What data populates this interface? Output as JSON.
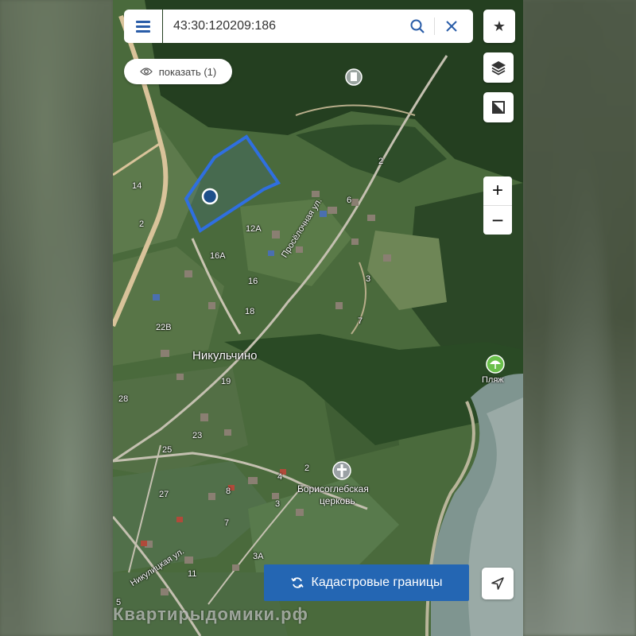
{
  "search": {
    "query": "43:30:120209:186"
  },
  "show_button": {
    "label": "показать (1)"
  },
  "cadastral_button": {
    "label": "Кадастровые границы"
  },
  "watermark": "Квартирыдомики.рф",
  "map": {
    "place_names": {
      "village": "Никульчино",
      "beach": "Пляж",
      "church_line1": "Борисоглебская",
      "church_line2": "церковь",
      "street1": "Просёлочная ул.",
      "street2": "Никулицкая ул."
    },
    "house_numbers": {
      "n14": "14",
      "n2a": "2",
      "n2b": "2",
      "n6": "6",
      "n12a": "12А",
      "n16a": "16А",
      "n16": "16",
      "n18": "18",
      "n3a": "3",
      "n7": "7",
      "n22v": "22В",
      "n19": "19",
      "n28": "28",
      "n23": "23",
      "n25": "25",
      "n2c": "2",
      "n4": "4",
      "n8": "8",
      "n3b": "3",
      "n27": "27",
      "n7b": "7",
      "n3A": "3А",
      "n11": "11",
      "n5": "5"
    },
    "colors": {
      "parcel": "#2f6fe0",
      "road": "#d9c39a",
      "accent": "#2466b3",
      "beach_icon": "#6abf4b"
    }
  }
}
